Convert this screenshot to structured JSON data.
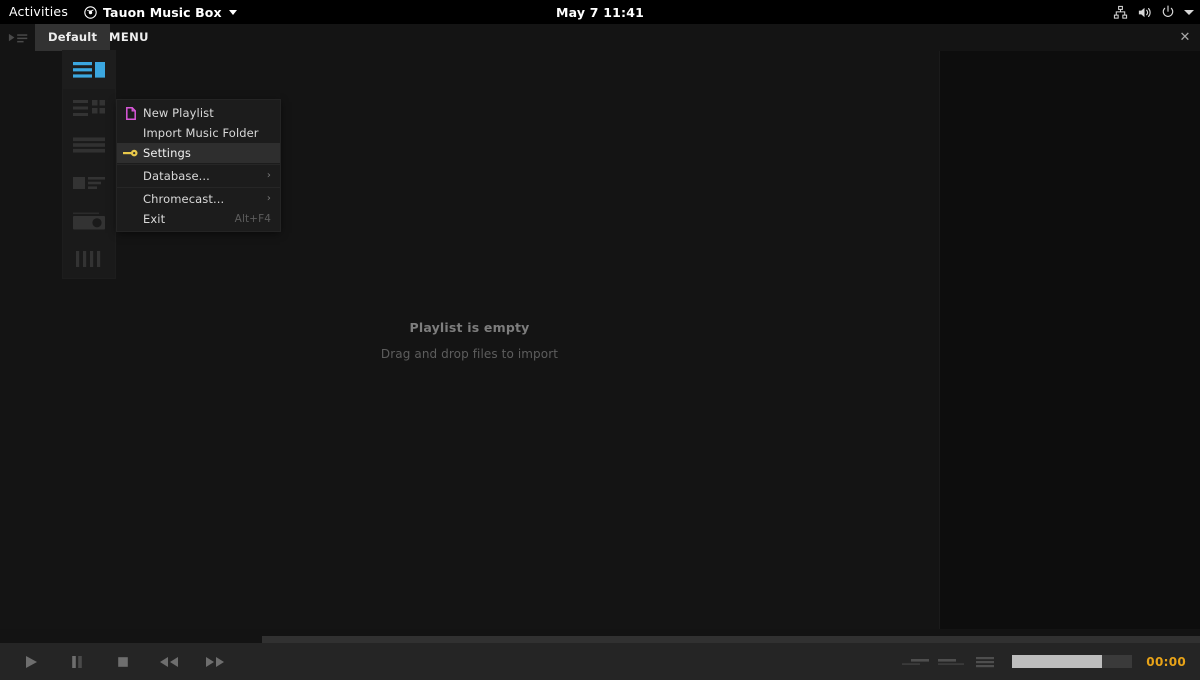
{
  "system_bar": {
    "activities_label": "Activities",
    "app_name": "Tauon Music Box",
    "app_icon": "music-disc-icon",
    "clock": "May 7  11:41",
    "tray": [
      {
        "name": "network-icon"
      },
      {
        "name": "volume-icon"
      },
      {
        "name": "power-icon"
      },
      {
        "name": "system-menu-caret-icon"
      }
    ]
  },
  "tabstrip": {
    "playlist_play_icon": "playlist-play-icon",
    "tabs": [
      {
        "label": "Default",
        "active": true
      }
    ],
    "menu_label": "MENU",
    "close_label": "✕"
  },
  "view_sidebar": {
    "items": [
      {
        "name": "view-mode-list-artbox",
        "icon": "layout-list-art-icon",
        "active": true
      },
      {
        "name": "view-mode-columns",
        "icon": "layout-columns-icon",
        "active": false
      },
      {
        "name": "view-mode-compact-list",
        "icon": "layout-rows-icon",
        "active": false
      },
      {
        "name": "view-mode-art-details",
        "icon": "layout-art-details-icon",
        "active": false
      },
      {
        "name": "view-mode-gallery",
        "icon": "layout-gallery-icon",
        "active": false
      },
      {
        "name": "view-mode-spectrum",
        "icon": "layout-bars-icon",
        "active": false
      }
    ]
  },
  "menu": {
    "items": [
      {
        "label": "New Playlist",
        "icon": "new-playlist-icon",
        "icon_color": "#d957d9",
        "selected": false,
        "submenu": false,
        "accel": ""
      },
      {
        "label": "Import Music Folder",
        "icon": "",
        "selected": false,
        "submenu": false,
        "accel": ""
      },
      {
        "label": "Settings",
        "icon": "key-icon",
        "icon_color": "#e8c84a",
        "selected": true,
        "submenu": false,
        "accel": ""
      },
      {
        "label": "Database...",
        "icon": "",
        "selected": false,
        "submenu": true,
        "accel": ""
      },
      {
        "label": "Chromecast...",
        "icon": "",
        "selected": false,
        "submenu": true,
        "accel": ""
      },
      {
        "label": "Exit",
        "icon": "",
        "selected": false,
        "submenu": false,
        "accel": "Alt+F4"
      }
    ]
  },
  "playlist": {
    "empty_title": "Playlist is empty",
    "empty_subtitle": "Drag and drop files to import"
  },
  "player": {
    "transport": [
      {
        "name": "play-button",
        "icon": "play-icon"
      },
      {
        "name": "pause-button",
        "icon": "pause-icon"
      },
      {
        "name": "stop-button",
        "icon": "stop-icon"
      },
      {
        "name": "previous-button",
        "icon": "rewind-icon"
      },
      {
        "name": "next-button",
        "icon": "fast-forward-icon"
      }
    ],
    "seek_progress_percent": 0,
    "right_controls": [
      {
        "name": "shuffle-toggle",
        "icon": "shuffle-icon"
      },
      {
        "name": "repeat-toggle",
        "icon": "repeat-icon"
      },
      {
        "name": "queue-button",
        "icon": "queue-icon"
      }
    ],
    "volume_percent": 75,
    "time_display": "00:00"
  },
  "colors": {
    "accent_blue": "#3ba7e0",
    "time_amber": "#e8a318",
    "menu_highlight": "#2e2e2e",
    "window_bg": "#141414",
    "player_bg": "#252525"
  }
}
